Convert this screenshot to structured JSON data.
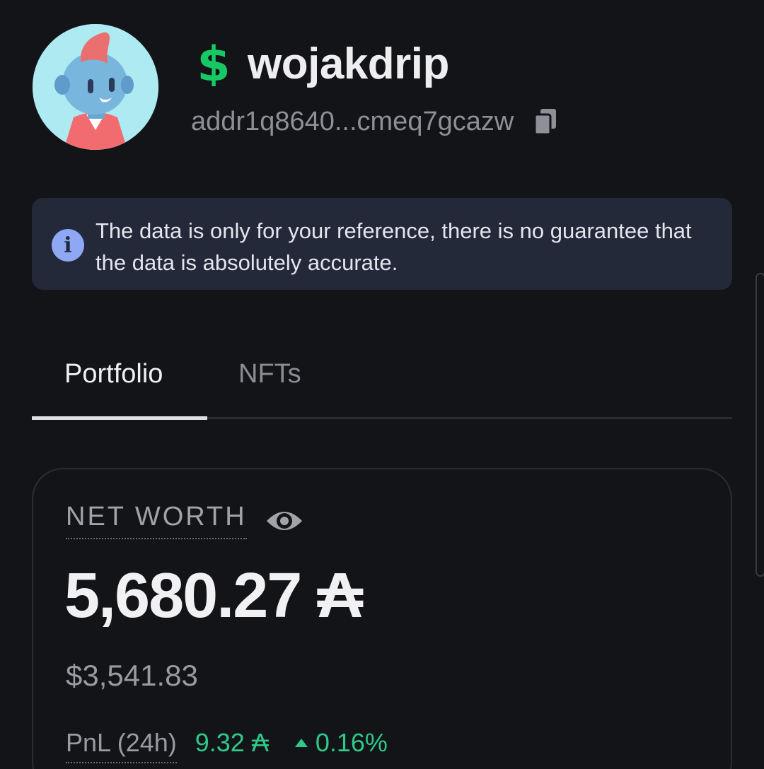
{
  "profile": {
    "username": "wojakdrip",
    "address": "addr1q8640...cmeq7gcazw",
    "avatar_icon": "wojak-avatar",
    "username_icon": "dollar-sign-icon",
    "copy_icon": "copy-icon"
  },
  "banner": {
    "icon": "info-icon",
    "icon_glyph": "i",
    "text": "The data is only for your reference, there is no guarantee that the data is absolutely accurate."
  },
  "tabs": [
    {
      "label": "Portfolio",
      "active": true
    },
    {
      "label": "NFTs",
      "active": false
    }
  ],
  "portfolio": {
    "net_worth_label": "NET WORTH",
    "net_worth_value": "5,680.27 ₳",
    "usd_value": "$3,541.83",
    "pnl_label": "PnL (24h)",
    "pnl_value": "9.32 ₳",
    "pnl_percent": "0.16%",
    "pnl_direction": "up"
  },
  "colors": {
    "background": "#131417",
    "banner_bg": "#242939",
    "accent_green": "#2ec88a",
    "info_blue": "#8ea8f5",
    "dollar_green": "#17c964"
  }
}
